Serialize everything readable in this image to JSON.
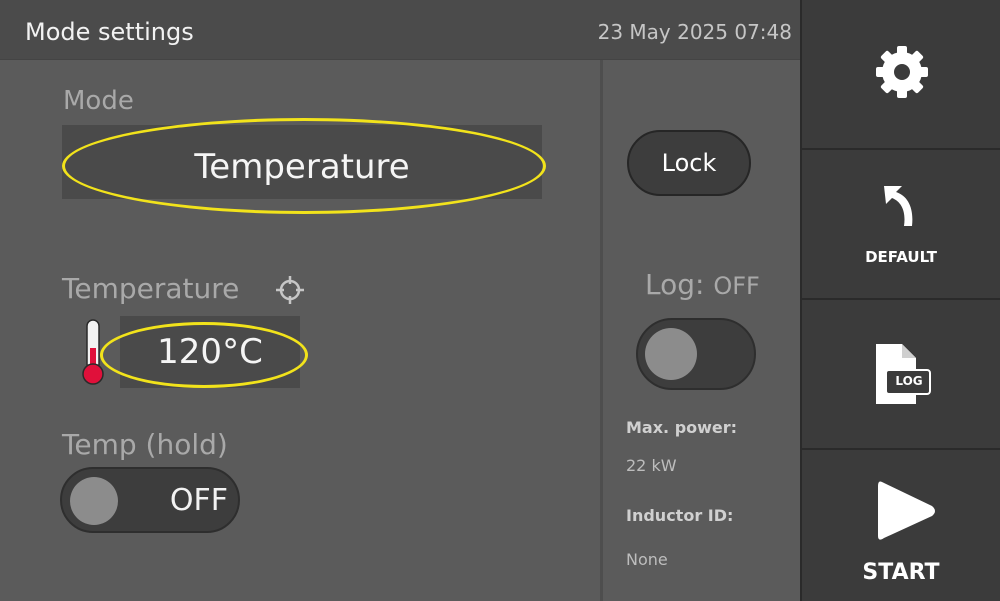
{
  "header": {
    "title": "Mode settings",
    "datetime": "23 May 2025 07:48"
  },
  "mode": {
    "label": "Mode",
    "value": "Temperature"
  },
  "temperature": {
    "label": "Temperature",
    "value": "120°C",
    "icon": "thermometer-icon",
    "target_icon": "crosshair-icon"
  },
  "temp_hold": {
    "label": "Temp (hold)",
    "state": "OFF"
  },
  "lock": {
    "label": "Lock"
  },
  "log": {
    "label": "Log:",
    "state": "OFF"
  },
  "info": {
    "max_power_label": "Max. power:",
    "max_power_value": "22 kW",
    "inductor_label": "Inductor ID:",
    "inductor_value": "None"
  },
  "sidebar": {
    "settings_icon": "gear-icon",
    "default_label": "DEFAULT",
    "default_icon": "return-arrow-icon",
    "log_icon": "log-file-icon",
    "log_icon_text": "LOG",
    "start_label": "START",
    "start_icon": "play-icon"
  },
  "colors": {
    "highlight": "#f2e31b",
    "thermometer": "#e0103a"
  }
}
